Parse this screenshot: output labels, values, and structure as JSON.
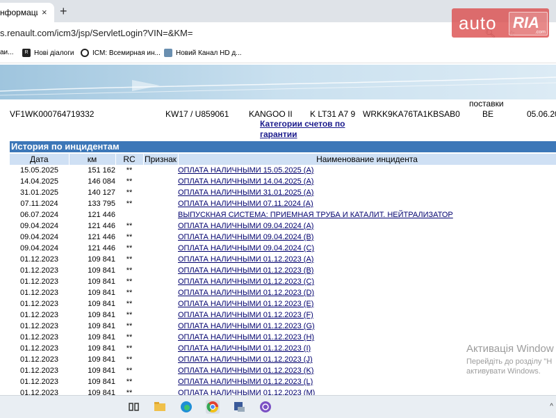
{
  "browser": {
    "tab_title": "нформацио",
    "tab_close": "×",
    "new_tab": "+",
    "url": "s.renault.com/icm3/jsp/ServletLogin?VIN=&KM=",
    "bookmarks": [
      {
        "label": "аи...",
        "icon": "bookmark-folder-icon"
      },
      {
        "label": "Нові діалоги",
        "icon": "ro-icon"
      },
      {
        "label": "ICM: Всемирная ин...",
        "icon": "globe-icon"
      },
      {
        "label": "Новий Канал HD д...",
        "icon": "channel-icon"
      }
    ]
  },
  "watermark": {
    "auto": "auto",
    "ria": "RIA",
    "com": ".com"
  },
  "vehicle": {
    "header_partial": "поставки",
    "vin": "VF1WK000764719332",
    "code": "KW17 / U859061",
    "model": "KANGOO II",
    "engine": "K LT31 A7 9",
    "vin2": "WRKK9KA76TA1KBSAB0",
    "country": "BE",
    "date": "05.06.20"
  },
  "category_link": "Категории счетов по гарантии",
  "history": {
    "title": "История по инцидентам",
    "headers": [
      "Дата",
      "км",
      "RC",
      "Признак",
      "Наименование инцидента"
    ],
    "rows": [
      {
        "date": "15.05.2025",
        "km": "151 162",
        "rc": "**",
        "name": "ОПЛАТА НАЛИЧНЫМИ 15.05.2025 (A)"
      },
      {
        "date": "14.04.2025",
        "km": "146 084",
        "rc": "**",
        "name": "ОПЛАТА НАЛИЧНЫМИ 14.04.2025 (A)"
      },
      {
        "date": "31.01.2025",
        "km": "140 127",
        "rc": "**",
        "name": "ОПЛАТА НАЛИЧНЫМИ 31.01.2025 (A)"
      },
      {
        "date": "07.11.2024",
        "km": "133 795",
        "rc": "**",
        "name": "ОПЛАТА НАЛИЧНЫМИ 07.11.2024 (A)"
      },
      {
        "date": "06.07.2024",
        "km": "121 446",
        "rc": "",
        "name": "ВЫПУСКНАЯ СИСТЕМА: ПРИЕМНАЯ ТРУБА И КАТАЛИТ. НЕЙТРАЛИЗАТОР"
      },
      {
        "date": "09.04.2024",
        "km": "121 446",
        "rc": "**",
        "name": "ОПЛАТА НАЛИЧНЫМИ 09.04.2024 (A)"
      },
      {
        "date": "09.04.2024",
        "km": "121 446",
        "rc": "**",
        "name": "ОПЛАТА НАЛИЧНЫМИ 09.04.2024 (B)"
      },
      {
        "date": "09.04.2024",
        "km": "121 446",
        "rc": "**",
        "name": "ОПЛАТА НАЛИЧНЫМИ 09.04.2024 (C)"
      },
      {
        "date": "01.12.2023",
        "km": "109 841",
        "rc": "**",
        "name": "ОПЛАТА НАЛИЧНЫМИ 01.12.2023 (A)"
      },
      {
        "date": "01.12.2023",
        "km": "109 841",
        "rc": "**",
        "name": "ОПЛАТА НАЛИЧНЫМИ 01.12.2023 (B)"
      },
      {
        "date": "01.12.2023",
        "km": "109 841",
        "rc": "**",
        "name": "ОПЛАТА НАЛИЧНЫМИ 01.12.2023 (C)"
      },
      {
        "date": "01.12.2023",
        "km": "109 841",
        "rc": "**",
        "name": "ОПЛАТА НАЛИЧНЫМИ 01.12.2023 (D)"
      },
      {
        "date": "01.12.2023",
        "km": "109 841",
        "rc": "**",
        "name": "ОПЛАТА НАЛИЧНЫМИ 01.12.2023 (E)"
      },
      {
        "date": "01.12.2023",
        "km": "109 841",
        "rc": "**",
        "name": "ОПЛАТА НАЛИЧНЫМИ 01.12.2023 (F)"
      },
      {
        "date": "01.12.2023",
        "km": "109 841",
        "rc": "**",
        "name": "ОПЛАТА НАЛИЧНЫМИ 01.12.2023 (G)"
      },
      {
        "date": "01.12.2023",
        "km": "109 841",
        "rc": "**",
        "name": "ОПЛАТА НАЛИЧНЫМИ 01.12.2023 (H)"
      },
      {
        "date": "01.12.2023",
        "km": "109 841",
        "rc": "**",
        "name": "ОПЛАТА НАЛИЧНЫМИ 01.12.2023 (I)"
      },
      {
        "date": "01.12.2023",
        "km": "109 841",
        "rc": "**",
        "name": "ОПЛАТА НАЛИЧНЫМИ 01.12.2023 (J)"
      },
      {
        "date": "01.12.2023",
        "km": "109 841",
        "rc": "**",
        "name": "ОПЛАТА НАЛИЧНЫМИ 01.12.2023 (K)"
      },
      {
        "date": "01.12.2023",
        "km": "109 841",
        "rc": "**",
        "name": "ОПЛАТА НАЛИЧНЫМИ 01.12.2023 (L)"
      },
      {
        "date": "01.12.2023",
        "km": "109 841",
        "rc": "**",
        "name": "ОПЛАТА НАЛИЧНЫМИ 01.12.2023 (M)"
      }
    ]
  },
  "activation": {
    "line1": "Активація Window",
    "line2": "Перейдіть до розділу \"Н",
    "line3": "активувати Windows."
  },
  "taskbar": {
    "icons": [
      "task-view-icon",
      "file-explorer-icon",
      "edge-icon",
      "chrome-icon",
      "app-icon",
      "viber-icon"
    ],
    "tray": "^"
  },
  "colors": {
    "section_bg": "#3c77b8",
    "header_bg": "#cfe0f4",
    "link": "#00006e",
    "watermark_red": "#dc5050"
  }
}
